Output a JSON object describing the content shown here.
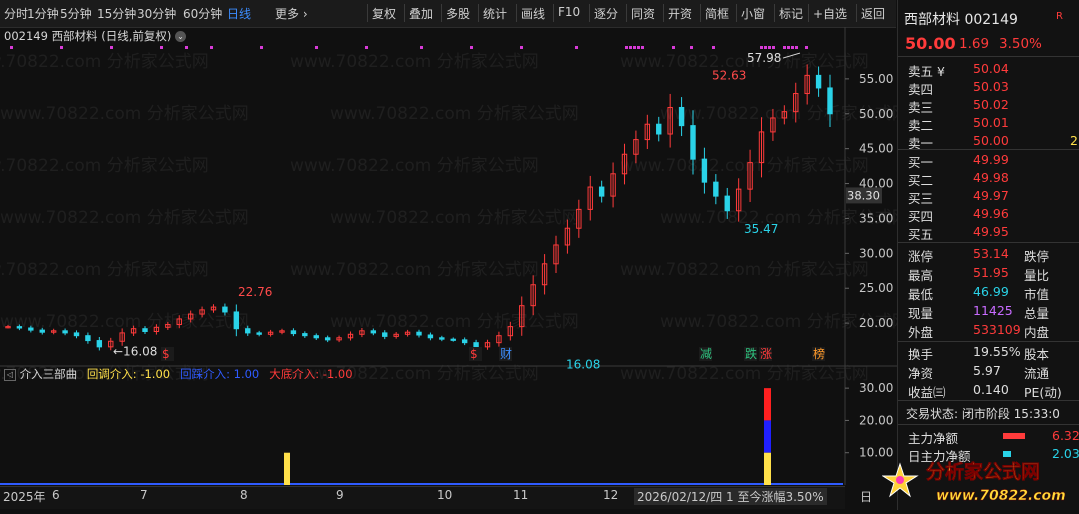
{
  "toolbar": {
    "tabs": [
      "分时",
      "1分钟",
      "5分钟",
      "15分钟",
      "30分钟",
      "60分钟",
      "日线",
      "更多 ›"
    ],
    "active_tab": "日线",
    "tools": [
      "复权",
      "叠加",
      "多股",
      "统计",
      "画线",
      "F10",
      "逐分",
      "同资",
      "开资",
      "简框",
      "小窗",
      "标记",
      "+自选",
      "返回"
    ]
  },
  "stock_header": {
    "code": "002149",
    "name": "西部材料",
    "mode": "(日线,前复权)"
  },
  "watermark": "www.70822.com 分析家公式网",
  "price_axis": {
    "ticks": [
      "55.00",
      "50.00",
      "45.00",
      "40.00",
      "35.00",
      "30.00",
      "25.00",
      "20.00"
    ],
    "current_label": "38.30"
  },
  "annotations": {
    "high_label": "57.98",
    "peak1": "52.63",
    "trough": "35.47",
    "mid_high": "22.76",
    "low1": "16.08",
    "low2": "16.08"
  },
  "event_markers": [
    {
      "text": "$",
      "color": "#ff3b3b"
    },
    {
      "text": "$",
      "color": "#ff3b3b"
    },
    {
      "text": "财",
      "color": "#3c8dff"
    },
    {
      "text": "减",
      "color": "#2ec27e"
    },
    {
      "text": "跌",
      "color": "#2ec27e"
    },
    {
      "text": "涨",
      "color": "#ff3b3b"
    },
    {
      "text": "榜",
      "color": "#ff9a2a"
    }
  ],
  "indicator": {
    "name": "介入三部曲",
    "lines": [
      {
        "label": "回调介入: -1.00",
        "color": "#ffe04a"
      },
      {
        "label": "回踩介入: 1.00",
        "color": "#2f5bff"
      },
      {
        "label": "大底介入: -1.00",
        "color": "#ff3b3b"
      }
    ],
    "axis_ticks": [
      "30.00",
      "20.00",
      "10.00"
    ]
  },
  "x_axis": {
    "labels": [
      "2025年",
      "6",
      "7",
      "8",
      "9",
      "10",
      "11",
      "12"
    ],
    "status": "2026/02/12/四 1 至今涨幅3.50%",
    "right": "日"
  },
  "quote": {
    "title_name": "西部材料",
    "title_code": "002149",
    "price": "50.00",
    "change": "1.69",
    "pct": "3.50%",
    "badge": "R",
    "asks": [
      {
        "label": "卖五 ¥",
        "price": "50.04"
      },
      {
        "label": "卖四",
        "price": "50.03"
      },
      {
        "label": "卖三",
        "price": "50.02"
      },
      {
        "label": "卖二",
        "price": "50.01"
      },
      {
        "label": "卖一",
        "price": "50.00",
        "vol": "2"
      }
    ],
    "bids": [
      {
        "label": "买一",
        "price": "49.99"
      },
      {
        "label": "买二",
        "price": "49.98"
      },
      {
        "label": "买三",
        "price": "49.97"
      },
      {
        "label": "买四",
        "price": "49.96"
      },
      {
        "label": "买五",
        "price": "49.95"
      }
    ],
    "stats": [
      {
        "label": "涨停",
        "value": "53.14",
        "value_color": "#ff3b3b",
        "right": "跌停"
      },
      {
        "label": "最高",
        "value": "51.95",
        "value_color": "#ff3b3b",
        "right": "量比"
      },
      {
        "label": "最低",
        "value": "46.99",
        "value_color": "#2ad3e8",
        "right": "市值"
      },
      {
        "label": "现量",
        "value": "11425",
        "value_color": "#c86bff",
        "right": "总量"
      },
      {
        "label": "外盘",
        "value": "533109",
        "value_color": "#ff3b3b",
        "right": "内盘"
      }
    ],
    "stats2": [
      {
        "label": "换手",
        "value": "19.55%",
        "right": "股本"
      },
      {
        "label": "净资",
        "value": "5.97",
        "right": "流通"
      },
      {
        "label": "收益㈢",
        "value": "0.140",
        "right": "PE(动)"
      }
    ],
    "trade_status": "交易状态: 闭市阶段 15:33:0",
    "flows": [
      {
        "label": "主力净额",
        "value": "6.32",
        "color": "#ff3b3b"
      },
      {
        "label": "日主力净额",
        "value": "2.03",
        "color": "#2ad3e8"
      }
    ]
  },
  "logo": {
    "title": "分析家公式网",
    "url": "www.70822.com"
  },
  "chart_data": {
    "type": "candlestick",
    "title": "",
    "ylim": [
      14,
      61
    ],
    "x": [
      "2025-05",
      "2025-06",
      "2025-07",
      "2025-08",
      "2025-09",
      "2025-10",
      "2025-11",
      "2025-12",
      "2026-01",
      "2026-02"
    ],
    "close_path": [
      19.5,
      19.3,
      19.0,
      18.7,
      18.9,
      18.6,
      18.2,
      17.5,
      16.6,
      17.4,
      18.6,
      19.2,
      18.8,
      19.4,
      19.8,
      20.6,
      21.3,
      21.9,
      22.3,
      21.6,
      19.2,
      18.6,
      18.4,
      18.7,
      18.9,
      18.5,
      18.2,
      17.9,
      17.6,
      17.9,
      18.4,
      18.9,
      18.6,
      18.1,
      18.4,
      18.7,
      18.3,
      17.9,
      17.7,
      17.6,
      17.2,
      16.6,
      17.2,
      18.2,
      19.5,
      22.5,
      25.5,
      28.5,
      31.2,
      33.6,
      36.3,
      39.5,
      38.2,
      41.4,
      44.2,
      46.3,
      48.5,
      47.1,
      50.9,
      48.3,
      43.5,
      40.2,
      38.2,
      36.1,
      39.2,
      43.0,
      47.4,
      49.4,
      50.3,
      52.9,
      55.5,
      53.7,
      50.0
    ],
    "indicator_bars": [
      {
        "x": "2025-08",
        "value": 10,
        "color": "yellow"
      },
      {
        "x": "2026-02",
        "value": 30,
        "segments": [
          "red",
          "blue",
          "yellow"
        ]
      }
    ]
  }
}
